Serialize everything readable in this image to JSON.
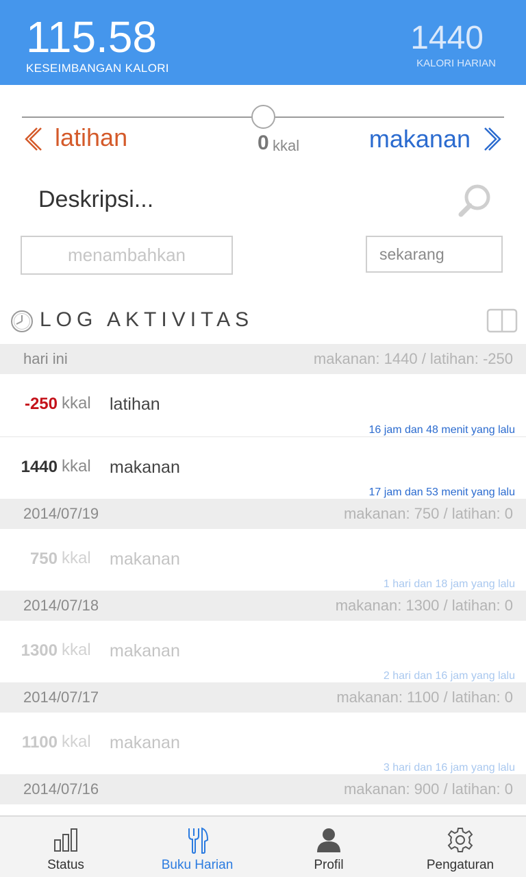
{
  "header": {
    "balance_value": "115.58",
    "balance_label": "KESEIMBANGAN KALORI",
    "daily_value": "1440",
    "daily_label": "KALORI HARIAN",
    "bg_color": "#4596ec"
  },
  "slider": {
    "left_label": "latihan",
    "right_label": "makanan",
    "value": "0",
    "unit": "kkal",
    "left_color": "#d45a2a",
    "right_color": "#2b6bcf"
  },
  "entry_form": {
    "description_placeholder": "Deskripsi...",
    "add_button": "menambahkan",
    "time_value": "sekarang"
  },
  "log": {
    "title": "LOG AKTIVITAS",
    "days": [
      {
        "date": "hari ini",
        "summary": "makanan: 1440 / latihan: -250",
        "entries": [
          {
            "amount": "-250",
            "unit": "kkal",
            "type": "latihan",
            "time": "16 jam dan 48 menit yang lalu",
            "amount_color": "#c4121a"
          },
          {
            "amount": "1440",
            "unit": "kkal",
            "type": "makanan",
            "time": "17 jam dan 53 menit yang lalu",
            "amount_color": "#333333"
          }
        ]
      },
      {
        "date": "2014/07/19",
        "summary": "makanan: 750 / latihan: 0",
        "entries": [
          {
            "amount": "750",
            "unit": "kkal",
            "type": "makanan",
            "time": "1 hari dan 18 jam yang lalu"
          }
        ]
      },
      {
        "date": "2014/07/18",
        "summary": "makanan: 1300 / latihan: 0",
        "entries": [
          {
            "amount": "1300",
            "unit": "kkal",
            "type": "makanan",
            "time": "2 hari dan 16 jam yang lalu"
          }
        ]
      },
      {
        "date": "2014/07/17",
        "summary": "makanan: 1100 / latihan: 0",
        "entries": [
          {
            "amount": "1100",
            "unit": "kkal",
            "type": "makanan",
            "time": "3 hari dan 16 jam yang lalu"
          }
        ]
      },
      {
        "date": "2014/07/16",
        "summary": "makanan: 900 / latihan: 0",
        "entries": []
      }
    ]
  },
  "nav": {
    "items": [
      {
        "label": "Status",
        "icon": "bar-chart-icon"
      },
      {
        "label": "Buku Harian",
        "icon": "fork-knife-icon",
        "active": true
      },
      {
        "label": "Profil",
        "icon": "person-icon"
      },
      {
        "label": "Pengaturan",
        "icon": "gear-icon"
      }
    ],
    "active_color": "#2b7be0"
  }
}
